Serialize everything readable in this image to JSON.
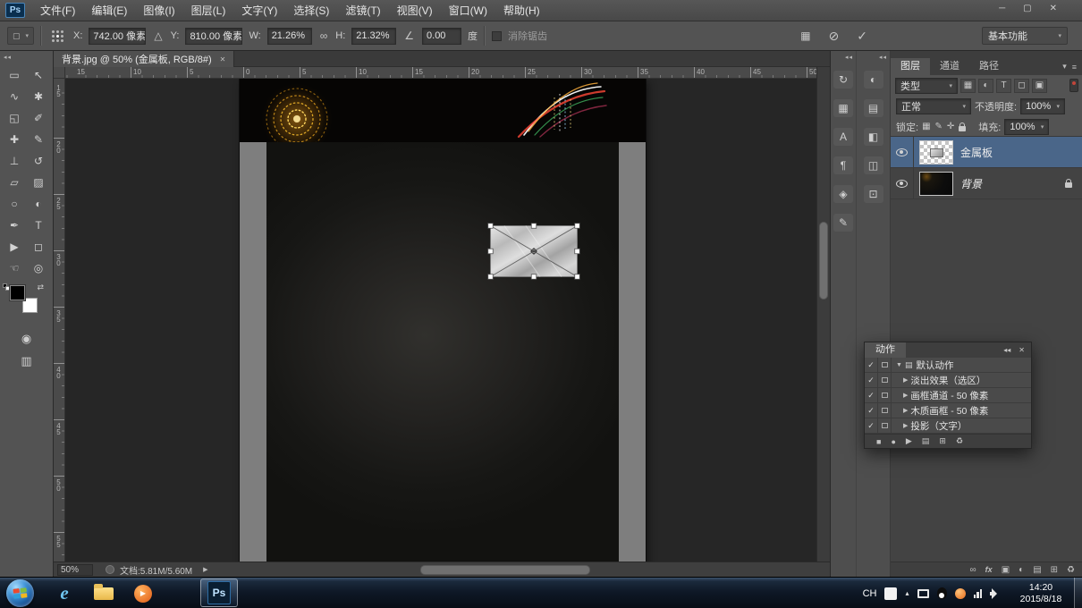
{
  "ui": {
    "caret": "▾"
  },
  "titlebar": {
    "logo": "Ps",
    "menus": [
      "文件(F)",
      "编辑(E)",
      "图像(I)",
      "图层(L)",
      "文字(Y)",
      "选择(S)",
      "滤镜(T)",
      "视图(V)",
      "窗口(W)",
      "帮助(H)"
    ],
    "min": "─",
    "max": "▢",
    "close": "✕"
  },
  "options": {
    "x_label": "X:",
    "x_value": "742.00 像素",
    "delta": "△",
    "y_label": "Y:",
    "y_value": "810.00 像素",
    "w_label": "W:",
    "w_value": "21.26%",
    "link": "∞",
    "h_label": "H:",
    "h_value": "21.32%",
    "angle": "∠",
    "angle_value": "0.00",
    "angle_unit": "度",
    "antialias": "消除锯齿",
    "warp": "▦",
    "cancel": "⊘",
    "commit": "✓",
    "workspace": "基本功能"
  },
  "doc": {
    "tab": "背景.jpg @ 50% (金属板, RGB/8#)",
    "close": "✕",
    "ruler_top": [
      "15",
      "10",
      "5",
      "0",
      "5",
      "10",
      "15",
      "20",
      "25",
      "30",
      "35",
      "40",
      "45",
      "50"
    ],
    "ruler_left": [
      "15",
      "20",
      "25",
      "30",
      "35",
      "40",
      "45",
      "50",
      "55"
    ],
    "zoom": "50%",
    "doc_size": "文档:5.81M/5.60M",
    "flyout": "▶"
  },
  "toolbox": {
    "collapse": "◂◂",
    "tools": [
      {
        "name": "rect-marquee",
        "glyph": "▭"
      },
      {
        "name": "move",
        "glyph": "↖"
      },
      {
        "name": "lasso",
        "glyph": "∿"
      },
      {
        "name": "quick-select",
        "glyph": "✱"
      },
      {
        "name": "crop",
        "glyph": "◱"
      },
      {
        "name": "eyedropper",
        "glyph": "✐"
      },
      {
        "name": "healing-brush",
        "glyph": "✚"
      },
      {
        "name": "brush",
        "glyph": "✎"
      },
      {
        "name": "clone-stamp",
        "glyph": "⊥"
      },
      {
        "name": "history-brush",
        "glyph": "↺"
      },
      {
        "name": "eraser",
        "glyph": "▱"
      },
      {
        "name": "gradient",
        "glyph": "▨"
      },
      {
        "name": "blur",
        "glyph": "○"
      },
      {
        "name": "dodge",
        "glyph": "◐"
      },
      {
        "name": "pen",
        "glyph": "✒"
      },
      {
        "name": "type",
        "glyph": "T"
      },
      {
        "name": "path-select",
        "glyph": "▶"
      },
      {
        "name": "shape",
        "glyph": "◻"
      },
      {
        "name": "hand",
        "glyph": "☜"
      },
      {
        "name": "zoom",
        "glyph": "◎"
      }
    ],
    "swap": "⇄",
    "quickmask": "◉",
    "screenmode": "▥"
  },
  "dock": {
    "collapse": "◂◂",
    "stripA": [
      {
        "name": "history-panel",
        "glyph": "↻"
      },
      {
        "name": "swatches-panel",
        "glyph": "▦"
      },
      {
        "name": "character-panel",
        "glyph": "A"
      },
      {
        "name": "paragraph-panel",
        "glyph": "¶"
      },
      {
        "name": "info-panel",
        "glyph": "◈"
      },
      {
        "name": "brush-panel",
        "glyph": "✎"
      }
    ],
    "stripB": [
      {
        "name": "adjustments-panel",
        "glyph": "◐"
      },
      {
        "name": "styles-panel",
        "glyph": "▤"
      },
      {
        "name": "color-panel",
        "glyph": "◧"
      },
      {
        "name": "properties-panel",
        "glyph": "◫"
      },
      {
        "name": "clone-source-panel",
        "glyph": "⊡"
      }
    ]
  },
  "layers": {
    "tabs": [
      "图层",
      "通道",
      "路径"
    ],
    "menu_caret": "▾",
    "panel_menu": "≡",
    "filter_label": "类型",
    "filter_icons": [
      {
        "name": "filter-pixel",
        "glyph": "▦"
      },
      {
        "name": "filter-adjustment",
        "glyph": "◐"
      },
      {
        "name": "filter-type",
        "glyph": "T"
      },
      {
        "name": "filter-shape",
        "glyph": "◻"
      },
      {
        "name": "filter-smartobject",
        "glyph": "▣"
      }
    ],
    "blend_mode": "正常",
    "opacity_label": "不透明度:",
    "opacity_value": "100%",
    "lock_label": "锁定:",
    "lock_icons": [
      {
        "name": "lock-transparency",
        "glyph": "▦"
      },
      {
        "name": "lock-pixels",
        "glyph": "✎"
      },
      {
        "name": "lock-position",
        "glyph": "✛"
      }
    ],
    "fill_label": "填充:",
    "fill_value": "100%",
    "rows": [
      {
        "name": "金属板"
      },
      {
        "name": "背景"
      }
    ],
    "bottom_icons": [
      {
        "name": "link-layers",
        "glyph": "∞"
      },
      {
        "name": "layer-styles",
        "glyph": "fx"
      },
      {
        "name": "layer-mask",
        "glyph": "▣"
      },
      {
        "name": "new-adjustment",
        "glyph": "◐"
      },
      {
        "name": "new-group",
        "glyph": "▤"
      },
      {
        "name": "new-layer",
        "glyph": "⊞"
      },
      {
        "name": "delete-layer",
        "glyph": "♻"
      }
    ]
  },
  "actions": {
    "title": "动作",
    "collapse": "◂◂",
    "close": "✕",
    "folder_icon": "▤",
    "rows": [
      {
        "check": "✓",
        "arrow": "▼",
        "label": "默认动作"
      },
      {
        "check": "✓",
        "arrow": "▶",
        "label": "淡出效果（选区）"
      },
      {
        "check": "✓",
        "arrow": "▶",
        "label": "画框通道 - 50 像素"
      },
      {
        "check": "✓",
        "arrow": "▶",
        "label": "木质画框 - 50 像素"
      },
      {
        "check": "✓",
        "arrow": "▶",
        "label": "投影（文字）"
      }
    ],
    "footer": [
      {
        "name": "stop",
        "glyph": "■"
      },
      {
        "name": "record",
        "glyph": "●"
      },
      {
        "name": "play",
        "glyph": "▶"
      },
      {
        "name": "new-set",
        "glyph": "▤"
      },
      {
        "name": "new-action",
        "glyph": "⊞"
      },
      {
        "name": "delete-action",
        "glyph": "♻"
      }
    ]
  },
  "taskbar": {
    "lang": "CH",
    "hidden": "▴",
    "ie": "e",
    "ps": "Ps",
    "time": "14:20",
    "date": "2015/8/18"
  }
}
